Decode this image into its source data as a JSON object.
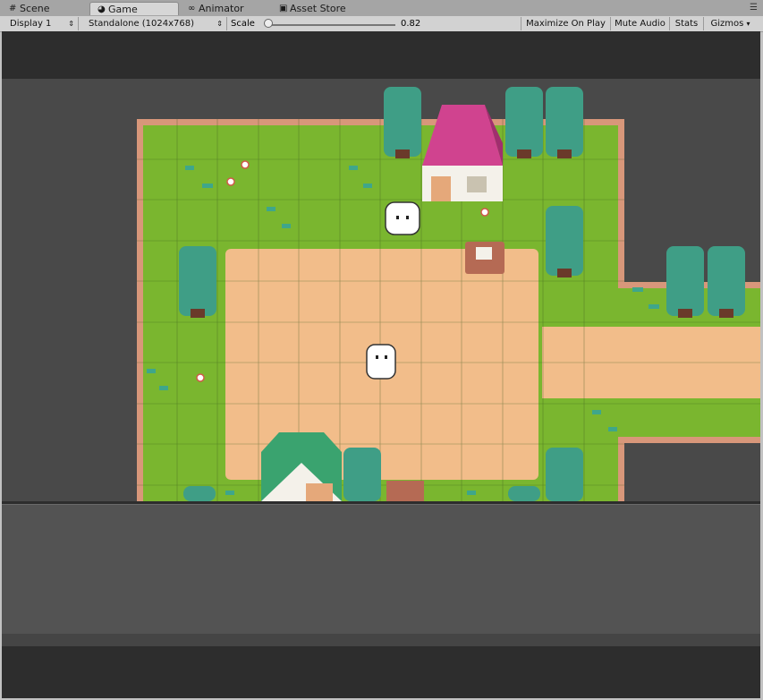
{
  "tabs": [
    {
      "label": "Scene",
      "icon": "grid-icon"
    },
    {
      "label": "Game",
      "icon": "pacman-icon"
    },
    {
      "label": "Animator",
      "icon": "animator-icon"
    },
    {
      "label": "Asset Store",
      "icon": "store-icon"
    }
  ],
  "toolbar": {
    "display": "Display 1",
    "resolution": "Standalone (1024x768)",
    "scale_label": "Scale",
    "scale_value": "0.82",
    "scale_fraction": 0.03,
    "maximize": "Maximize On Play",
    "mute": "Mute Audio",
    "stats": "Stats",
    "gizmos": "Gizmos"
  },
  "colors": {
    "grass": "#7ab62f",
    "dirt": "#f2bd8a",
    "tree": "#3f9e86",
    "roof_pink": "#d0438f",
    "roof_green": "#3aa36f",
    "border": "#d8977a"
  }
}
